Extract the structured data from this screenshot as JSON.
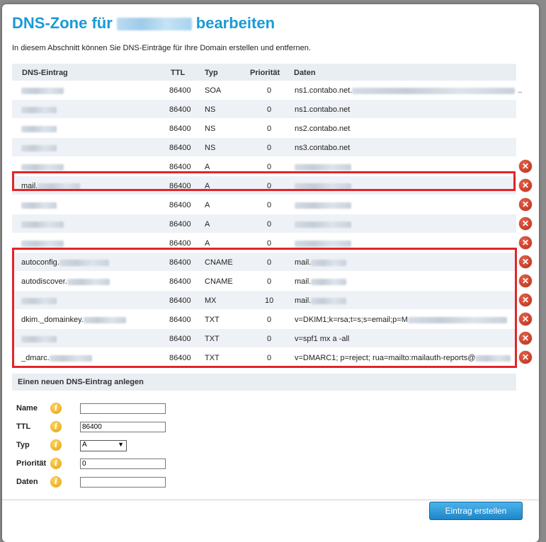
{
  "dialog": {
    "title_prefix": "DNS-Zone für",
    "title_suffix": "bearbeiten",
    "description": "In diesem Abschnitt können Sie DNS-Einträge für Ihre Domain erstellen und entfernen."
  },
  "table": {
    "headers": [
      "DNS-Eintrag",
      "TTL",
      "Typ",
      "Priorität",
      "Daten"
    ],
    "rows": [
      {
        "name": "",
        "ttl": "86400",
        "type": "SOA",
        "prio": "0",
        "data": "ns1.contabo.net.",
        "data_suffix": "..",
        "deletable": false
      },
      {
        "name": "",
        "ttl": "86400",
        "type": "NS",
        "prio": "0",
        "data": "ns1.contabo.net",
        "deletable": false
      },
      {
        "name": "",
        "ttl": "86400",
        "type": "NS",
        "prio": "0",
        "data": "ns2.contabo.net",
        "deletable": false
      },
      {
        "name": "",
        "ttl": "86400",
        "type": "NS",
        "prio": "0",
        "data": "ns3.contabo.net",
        "deletable": false
      },
      {
        "name": "",
        "ttl": "86400",
        "type": "A",
        "prio": "0",
        "data": "",
        "deletable": true
      },
      {
        "name": "mail.",
        "ttl": "86400",
        "type": "A",
        "prio": "0",
        "data": "",
        "deletable": true
      },
      {
        "name": "",
        "ttl": "86400",
        "type": "A",
        "prio": "0",
        "data": "",
        "deletable": true
      },
      {
        "name": "",
        "ttl": "86400",
        "type": "A",
        "prio": "0",
        "data": "",
        "deletable": true
      },
      {
        "name": "",
        "ttl": "86400",
        "type": "A",
        "prio": "0",
        "data": "",
        "deletable": true
      },
      {
        "name": "autoconfig.",
        "ttl": "86400",
        "type": "CNAME",
        "prio": "0",
        "data": "mail.",
        "deletable": true
      },
      {
        "name": "autodiscover.",
        "ttl": "86400",
        "type": "CNAME",
        "prio": "0",
        "data": "mail.",
        "deletable": true
      },
      {
        "name": "",
        "ttl": "86400",
        "type": "MX",
        "prio": "10",
        "data": "mail.",
        "deletable": true
      },
      {
        "name": "dkim._domainkey.",
        "ttl": "86400",
        "type": "TXT",
        "prio": "0",
        "data": "v=DKIM1;k=rsa;t=s;s=email;p=M",
        "deletable": true
      },
      {
        "name": "",
        "ttl": "86400",
        "type": "TXT",
        "prio": "0",
        "data": "v=spf1 mx a -all",
        "deletable": true
      },
      {
        "name": "_dmarc.",
        "ttl": "86400",
        "type": "TXT",
        "prio": "0",
        "data": "v=DMARC1; p=reject; rua=mailto:mailauth-reports@",
        "deletable": true
      }
    ]
  },
  "new_entry": {
    "section_title": "Einen neuen DNS-Eintrag anlegen",
    "name_label": "Name",
    "name_value": "",
    "ttl_label": "TTL",
    "ttl_value": "86400",
    "type_label": "Typ",
    "type_value": "A",
    "prio_label": "Priorität",
    "prio_value": "0",
    "data_label": "Daten",
    "data_value": "",
    "submit_label": "Eintrag erstellen"
  },
  "icons": {
    "delete": "delete-x-icon",
    "info": "info-icon"
  },
  "colors": {
    "title": "#1a9ad6",
    "highlight": "#e2242a",
    "delete": "#c8361c",
    "button": "#2a95d8"
  }
}
